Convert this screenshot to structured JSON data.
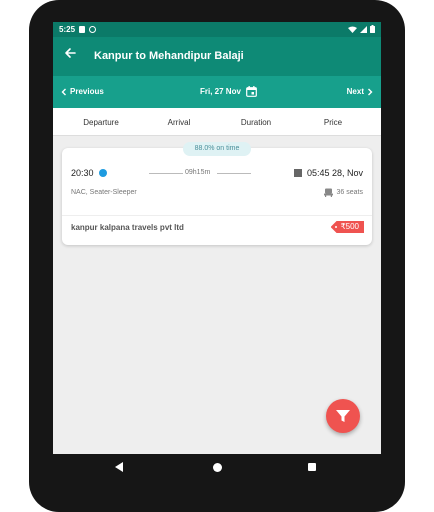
{
  "status_bar": {
    "time": "5:25"
  },
  "app_bar": {
    "title": "Kanpur to Mehandipur Balaji"
  },
  "date_bar": {
    "prev_label": "Previous",
    "date": "Fri, 27 Nov",
    "next_label": "Next"
  },
  "sort_bar": {
    "items": [
      "Departure",
      "Arrival",
      "Duration",
      "Price"
    ]
  },
  "result": {
    "on_time": "88.0% on time",
    "departure_time": "20:30",
    "duration": "09h15m",
    "arrival_time": "05:45 28, Nov",
    "bus_type": "NAC, Seater-Sleeper",
    "seats": "36 seats",
    "operator": "kanpur kalpana travels pvt ltd",
    "price": "₹500"
  },
  "colors": {
    "app_bar": "#0e8a76",
    "date_bar": "#17a08c",
    "accent_red": "#ef5350",
    "departure_dot": "#1e9be0"
  }
}
